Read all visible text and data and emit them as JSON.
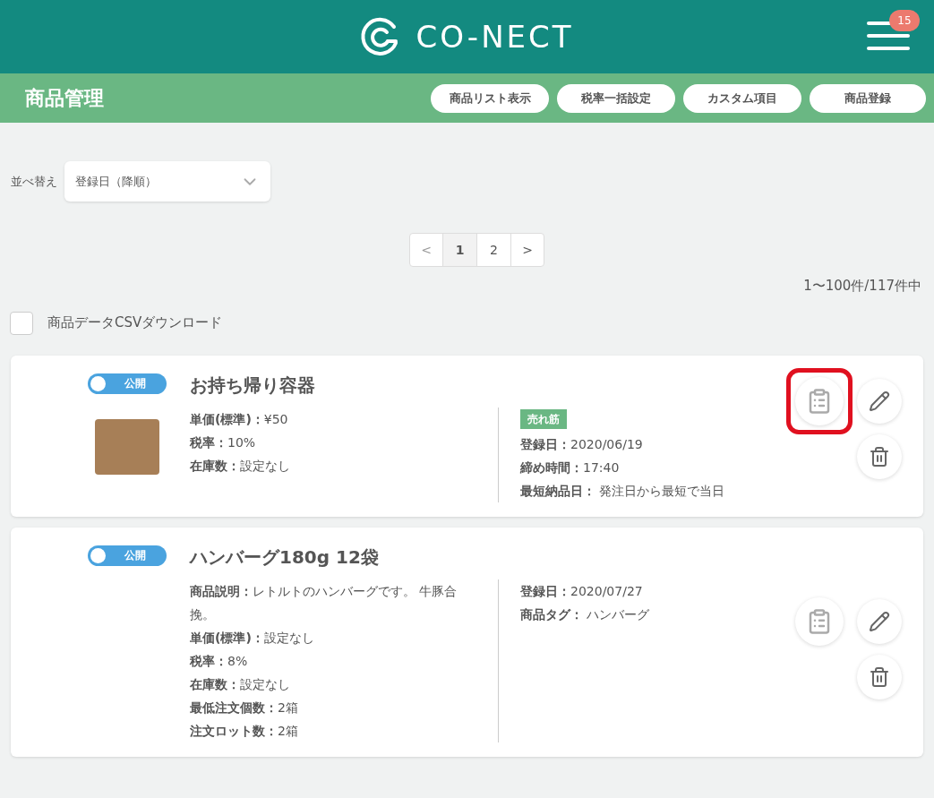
{
  "header": {
    "logo_text": "CO-NECT",
    "notification_count": "15"
  },
  "page_title": "商品管理",
  "header_buttons": [
    "商品リスト表示",
    "税率一括設定",
    "カスタム項目",
    "商品登録"
  ],
  "sort": {
    "label": "並べ替え",
    "value": "登録日（降順）"
  },
  "pagination": {
    "prev": "<",
    "next": ">",
    "pages": [
      {
        "label": "1",
        "selected": true
      },
      {
        "label": "2",
        "selected": false
      }
    ]
  },
  "result_count": "1〜100件/117件中",
  "csv_download": {
    "label": "商品データCSVダウンロード",
    "checked": false
  },
  "products": [
    {
      "status": "公開",
      "published": true,
      "name": "お持ち帰り容器",
      "has_image": true,
      "left_fields": [
        {
          "label": "単価(標準)：",
          "value": "¥50"
        },
        {
          "label": "税率：",
          "value": "10%"
        },
        {
          "label": "在庫数：",
          "value": "設定なし"
        }
      ],
      "tag_badge": "売れ筋",
      "right_fields": [
        {
          "label": "登録日：",
          "value": "2020/06/19"
        },
        {
          "label": "締め時間：",
          "value": "17:40"
        },
        {
          "label": "最短納品日：",
          "value": " 発注日から最短で当日"
        }
      ],
      "detail_highlighted": true
    },
    {
      "status": "公開",
      "published": true,
      "name": "ハンバーグ180g 12袋",
      "has_image": false,
      "left_fields": [
        {
          "label": "商品説明：",
          "value": "レトルトのハンバーグです。 牛豚合挽。"
        },
        {
          "label": "単価(標準)：",
          "value": "設定なし"
        },
        {
          "label": "税率：",
          "value": "8%"
        },
        {
          "label": "在庫数：",
          "value": "設定なし"
        },
        {
          "label": "最低注文個数：",
          "value": "2箱"
        },
        {
          "label": "注文ロット数：",
          "value": "2箱"
        }
      ],
      "right_fields": [
        {
          "label": "登録日：",
          "value": "2020/07/27"
        },
        {
          "label": "商品タグ：",
          "value": " ハンバーグ"
        }
      ],
      "detail_highlighted": false
    }
  ]
}
